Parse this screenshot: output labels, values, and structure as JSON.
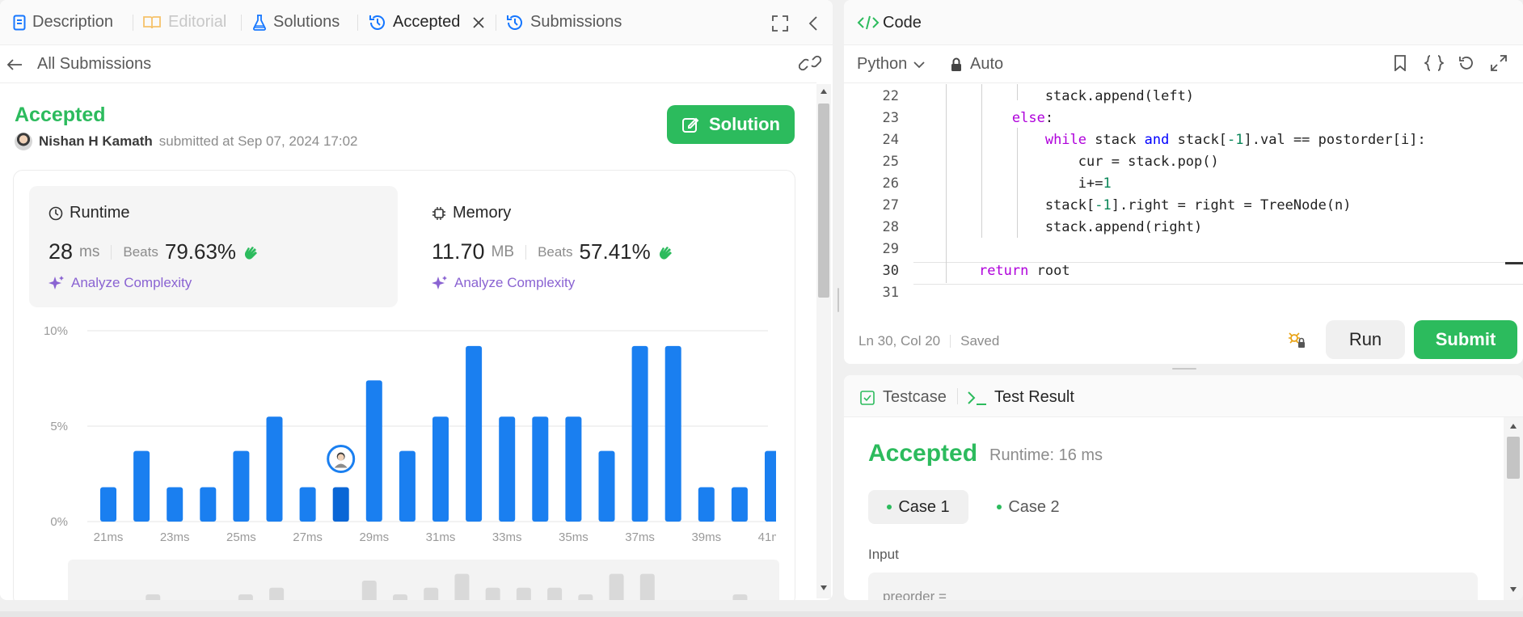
{
  "tabs": {
    "description": "Description",
    "editorial": "Editorial",
    "solutions": "Solutions",
    "accepted": "Accepted",
    "submissions": "Submissions"
  },
  "nav": {
    "back_label": "All Submissions"
  },
  "submission": {
    "status": "Accepted",
    "author": "Nishan H Kamath",
    "submitted_text": "submitted at Sep 07, 2024 17:02",
    "solution_button": "Solution"
  },
  "runtime": {
    "title": "Runtime",
    "value": "28",
    "unit": "ms",
    "beats_label": "Beats",
    "beats_value": "79.63%",
    "analyze_label": "Analyze Complexity"
  },
  "memory": {
    "title": "Memory",
    "value": "11.70",
    "unit": "MB",
    "beats_label": "Beats",
    "beats_value": "57.41%",
    "analyze_label": "Analyze Complexity"
  },
  "chart_data": {
    "type": "bar",
    "y_ticks": [
      "10%",
      "5%",
      "0%"
    ],
    "x_ticks": [
      "21ms",
      "23ms",
      "25ms",
      "27ms",
      "29ms",
      "31ms",
      "33ms",
      "35ms",
      "37ms",
      "39ms",
      "41ms"
    ],
    "categories": [
      "21ms",
      "22ms",
      "23ms",
      "24ms",
      "25ms",
      "26ms",
      "27ms",
      "28ms",
      "29ms",
      "30ms",
      "31ms",
      "32ms",
      "33ms",
      "34ms",
      "35ms",
      "36ms",
      "37ms",
      "38ms",
      "39ms",
      "40ms",
      "41ms"
    ],
    "values": [
      1.8,
      3.7,
      1.8,
      1.8,
      3.7,
      5.5,
      1.8,
      1.8,
      7.4,
      3.7,
      5.5,
      9.2,
      5.5,
      5.5,
      5.5,
      3.7,
      9.2,
      9.2,
      1.8,
      1.8,
      3.7
    ],
    "highlight_category": "28ms",
    "ylim": [
      0,
      10
    ],
    "grid": true,
    "bar_color": "#1a7ff0",
    "highlight_color": "#0a66d6"
  },
  "code_panel": {
    "title": "Code",
    "language": "Python",
    "mode": "Auto",
    "lines": [
      {
        "n": "22",
        "html": "            stack.append(left)"
      },
      {
        "n": "23",
        "html": "        else:"
      },
      {
        "n": "24",
        "html": "            while stack and stack[-1].val == postorder[i]:"
      },
      {
        "n": "25",
        "html": "                cur = stack.pop()"
      },
      {
        "n": "26",
        "html": "                i+=1"
      },
      {
        "n": "27",
        "html": "            stack[-1].right = right = TreeNode(n)"
      },
      {
        "n": "28",
        "html": "            stack.append(right)"
      },
      {
        "n": "29",
        "html": ""
      },
      {
        "n": "30",
        "html": "    return root"
      },
      {
        "n": "31",
        "html": ""
      }
    ],
    "cursor_pos": "Ln 30, Col 20",
    "save_status": "Saved",
    "run_label": "Run",
    "submit_label": "Submit"
  },
  "test_panel": {
    "testcase_tab": "Testcase",
    "result_tab": "Test Result",
    "status": "Accepted",
    "runtime_text": "Runtime: 16 ms",
    "cases": [
      "Case 1",
      "Case 2"
    ],
    "input_label": "Input",
    "input_preview": "preorder ="
  },
  "colors": {
    "accent_green": "#2cbb5d",
    "link_blue": "#1677ff",
    "analyze_purple": "#8a63d2"
  }
}
